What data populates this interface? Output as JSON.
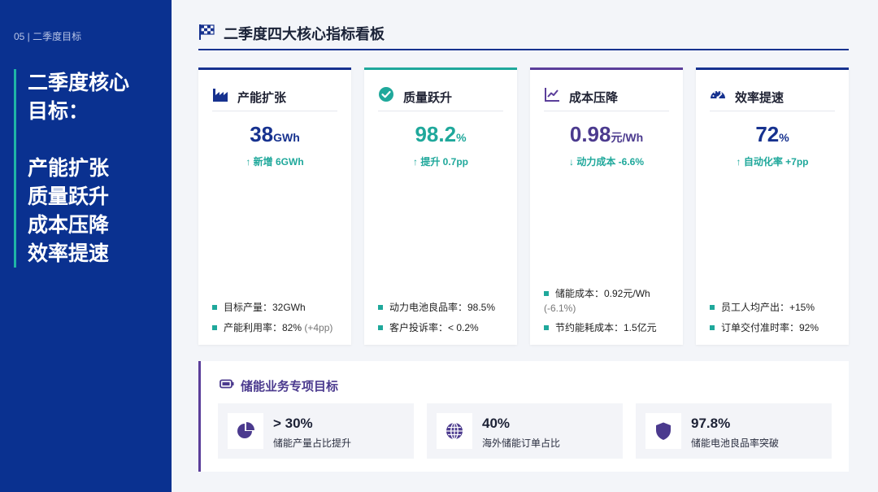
{
  "left": {
    "crumb": "05 | 二季度目标",
    "title_lines": [
      "二季度核心",
      "目标："
    ],
    "goal_lines": [
      "产能扩张",
      "质量跃升",
      "成本压降",
      "效率提速"
    ]
  },
  "header": {
    "title": "二季度四大核心指标看板"
  },
  "cards": [
    {
      "title": "产能扩张",
      "icon": "factory-icon",
      "accent": "#17328f",
      "value_color": "#17328f",
      "value": "38",
      "unit": "GWh",
      "delta": "↑ 新增 6GWh",
      "delta_color": "#1fa89b",
      "bullets": [
        {
          "text": "目标产量：32GWh",
          "note": ""
        },
        {
          "text": "产能利用率：82%",
          "note": " (+4pp)"
        }
      ]
    },
    {
      "title": "质量跃升",
      "icon": "check-circle-icon",
      "accent": "#1fa89b",
      "value_color": "#1fa89b",
      "value": "98.2",
      "unit": "%",
      "delta": "↑ 提升 0.7pp",
      "delta_color": "#1fa89b",
      "bullets": [
        {
          "text": "动力电池良品率：98.5%",
          "note": ""
        },
        {
          "text": "客户投诉率：< 0.2%",
          "note": ""
        }
      ]
    },
    {
      "title": "成本压降",
      "icon": "line-chart-icon",
      "accent": "#5b3e9a",
      "value_color": "#4b3a8e",
      "value": "0.98",
      "unit": "元/Wh",
      "delta": "↓ 动力成本 -6.6%",
      "delta_color": "#1fa89b",
      "bullets": [
        {
          "text": "储能成本：0.92元/Wh",
          "note": "(-6.1%)"
        },
        {
          "text": "节约能耗成本：1.5亿元",
          "note": ""
        }
      ]
    },
    {
      "title": "效率提速",
      "icon": "gauge-icon",
      "accent": "#17328f",
      "value_color": "#17328f",
      "value": "72",
      "unit": "%",
      "delta": "↑ 自动化率 +7pp",
      "delta_color": "#1fa89b",
      "bullets": [
        {
          "text": "员工人均产出：+15%",
          "note": ""
        },
        {
          "text": "订单交付准时率：92%",
          "note": ""
        }
      ]
    }
  ],
  "storage": {
    "title": "储能业务专项目标",
    "items": [
      {
        "value": "> 30%",
        "label": "储能产量占比提升",
        "icon": "pie-chart-icon"
      },
      {
        "value": "40%",
        "label": "海外储能订单占比",
        "icon": "globe-icon"
      },
      {
        "value": "97.8%",
        "label": "储能电池良品率突破",
        "icon": "shield-icon"
      }
    ]
  },
  "colors": {
    "navy": "#0a3190",
    "teal": "#1fa89b",
    "purple": "#5b3e9a"
  }
}
